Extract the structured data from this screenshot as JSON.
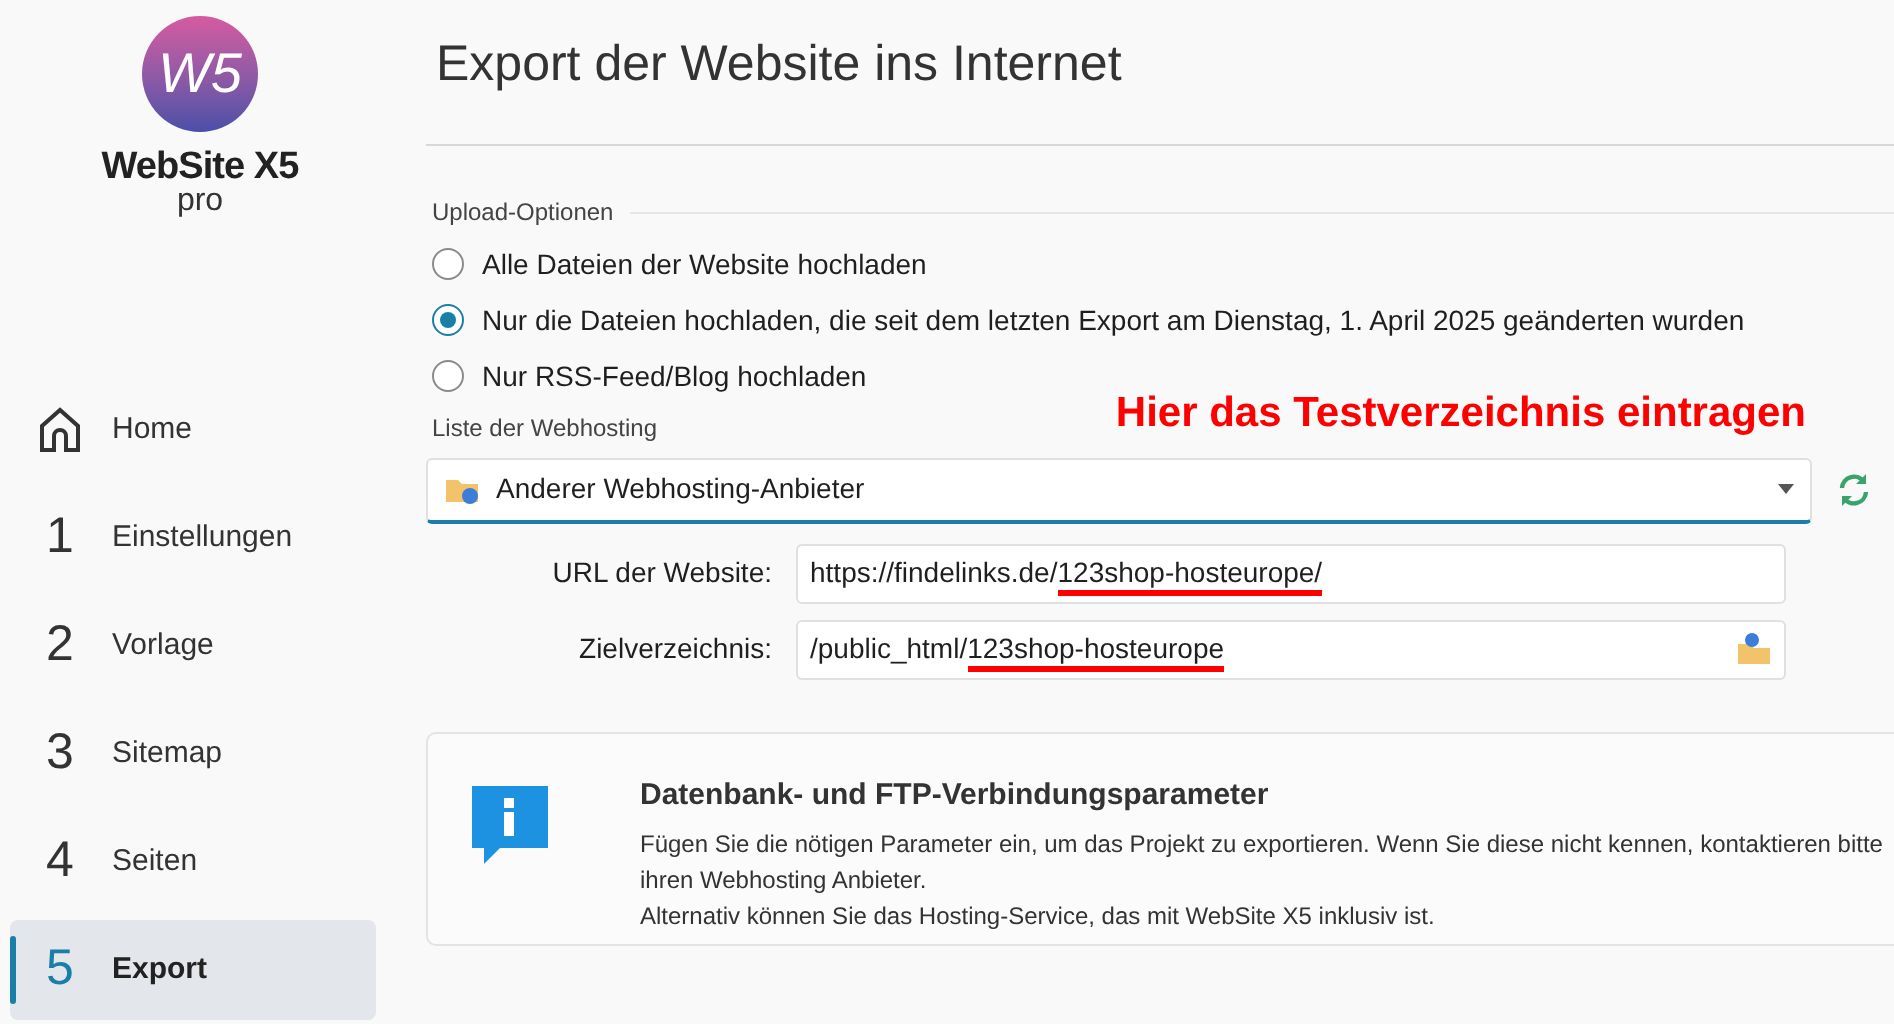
{
  "logo": {
    "mark": "W5",
    "name": "WebSite X5",
    "edition": "pro"
  },
  "sidebar": {
    "items": [
      {
        "kind": "home",
        "label": "Home",
        "selected": false
      },
      {
        "kind": "step",
        "number": "1",
        "label": "Einstellungen",
        "selected": false
      },
      {
        "kind": "step",
        "number": "2",
        "label": "Vorlage",
        "selected": false
      },
      {
        "kind": "step",
        "number": "3",
        "label": "Sitemap",
        "selected": false
      },
      {
        "kind": "step",
        "number": "4",
        "label": "Seiten",
        "selected": false
      },
      {
        "kind": "step",
        "number": "5",
        "label": "Export",
        "selected": true
      }
    ]
  },
  "title": "Export der Website ins Internet",
  "upload_options": {
    "label": "Upload-Optionen",
    "options": [
      {
        "label": "Alle Dateien der Website hochladen",
        "selected": false
      },
      {
        "label": "Nur die Dateien hochladen, die seit dem letzten Export am Dienstag, 1. April 2025 geänderten wurden",
        "selected": true
      },
      {
        "label": "Nur RSS-Feed/Blog hochladen",
        "selected": false
      }
    ]
  },
  "annotation": "Hier das Testverzeichnis eintragen",
  "hosting": {
    "label": "Liste der Webhosting",
    "value": "Anderer Webhosting-Anbieter"
  },
  "fields": [
    {
      "label": "URL der Website:",
      "kind": "text",
      "value_parts": [
        {
          "text": "https://findelinks.de/",
          "marked": false
        },
        {
          "text": "123shop-hosteurope/",
          "marked": true
        }
      ]
    },
    {
      "label": "Zielverzeichnis:",
      "kind": "folder",
      "value_parts": [
        {
          "text": "/public_html/",
          "marked": false
        },
        {
          "text": "123shop-hosteurope",
          "marked": true
        }
      ]
    }
  ],
  "info": {
    "title": "Datenbank- und FTP-Verbindungsparameter",
    "lines": [
      "Fügen Sie die nötigen Parameter ein, um das Projekt zu exportieren. Wenn Sie diese nicht kennen, kontaktieren bitte ihren Webhosting Anbieter.",
      "Alternativ können Sie das Hosting-Service, das mit WebSite X5 inklusiv ist."
    ]
  }
}
